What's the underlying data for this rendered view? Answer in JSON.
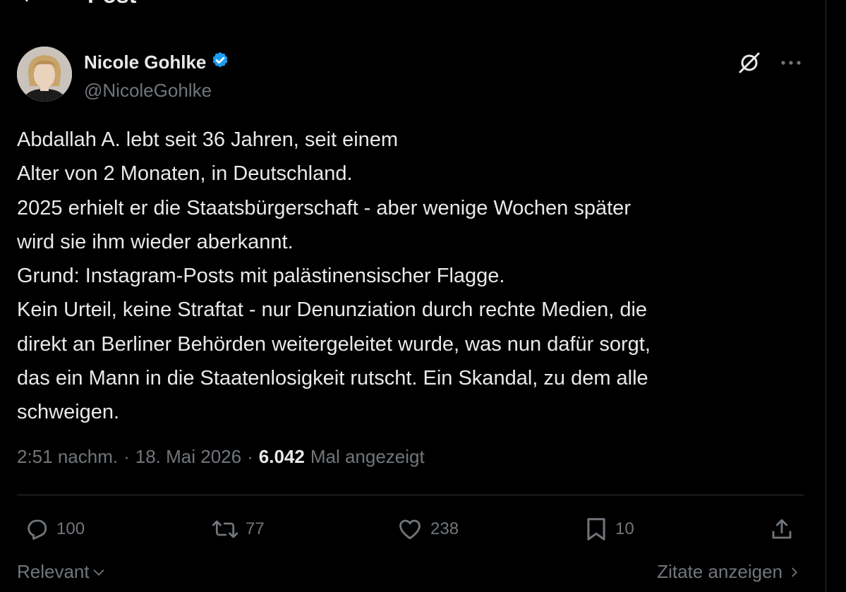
{
  "header": {
    "title": "Post"
  },
  "author": {
    "display_name": "Nicole Gohlke",
    "handle": "@NicoleGohlke",
    "verified": true,
    "verified_color": "#1d9bf0"
  },
  "post": {
    "lines": [
      "Abdallah A. lebt seit 36 Jahren, seit einem",
      "Alter von 2 Monaten, in Deutschland.",
      "2025 erhielt er die Staatsbürgerschaft - aber wenige Wochen später",
      "wird sie ihm wieder aberkannt.",
      "Grund: Instagram-Posts mit palästinensischer Flagge.",
      "Kein Urteil, keine Straftat - nur Denunziation durch rechte Medien, die",
      "direkt an Berliner Behörden weitergeleitet wurde, was nun dafür sorgt,",
      "das ein Mann in die Staatenlosigkeit rutscht. Ein Skandal, zu dem alle",
      "schweigen."
    ],
    "time": "2:51 nachm.",
    "separator": "·",
    "date": "18. Mai 2026",
    "views_count": "6.042",
    "views_label": "Mal angezeigt"
  },
  "actions": {
    "replies": "100",
    "reposts": "77",
    "likes": "238",
    "bookmarks": "10"
  },
  "footer": {
    "sort_label": "Relevant",
    "quotes_label": "Zitate anzeigen"
  },
  "colors": {
    "background": "#000000",
    "text": "#e7e9ea",
    "muted": "#71767b",
    "divider": "#2f3336"
  }
}
